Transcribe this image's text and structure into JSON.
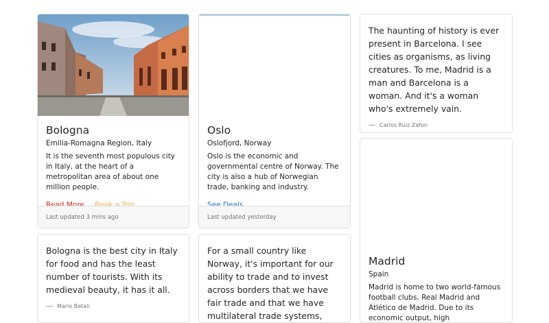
{
  "cards": [
    {
      "title": "Bologna",
      "subtitle": "Emilia-Romagna Region, Italy",
      "text": "It is the seventh most populous city in Italy, at the heart of a metropolitan area of about one million people.",
      "links": [
        "Read More",
        "Book a Trip"
      ],
      "footer": "Last updated 3 mins ago"
    },
    {
      "title": "Oslo",
      "subtitle": "Oslofjord, Norway",
      "text": "Oslo is the economic and governmental centre of Norway. The city is also a hub of Norwegian trade, banking and industry.",
      "links": [
        "See Deals"
      ],
      "footer": "Last updated yesterday"
    }
  ],
  "quotes": [
    {
      "text": "The haunting of history is ever present in Barcelona. I see cities as organisms, as living creatures. To me, Madrid is a man and Barcelona is a woman. And it's a woman who's extremely vain.",
      "author": "Carlos Ruiz Zafon"
    },
    {
      "text": "Bologna is the best city in Italy for food and has the least number of tourists. With its medieval beauty, it has it all.",
      "author": "Mario Batali"
    },
    {
      "text": "For a small country like Norway, it's important for our ability to trade and to invest across borders that we have fair trade and that we have multilateral trade systems, also.",
      "author": ""
    }
  ],
  "madrid": {
    "title": "Madrid",
    "subtitle": "Spain",
    "text": "Madrid is home to two world-famous football clubs, Real Madrid and Atlético de Madrid. Due to its economic output, high"
  },
  "colors": {
    "link_red": "#c9302c",
    "link_yellow": "#f0ad4e",
    "link_blue": "#1a73c8"
  }
}
